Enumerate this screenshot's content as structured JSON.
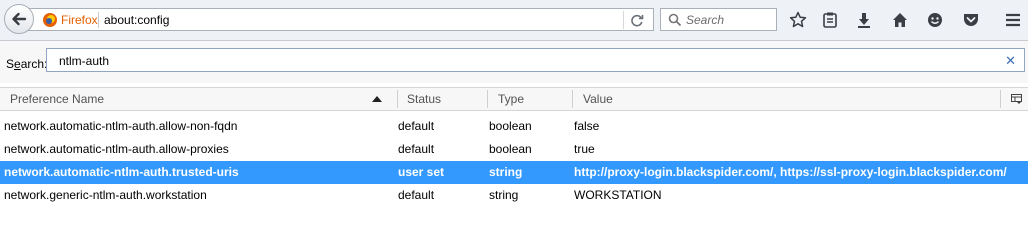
{
  "toolbar": {
    "brand_label": "Firefox",
    "url": "about:config",
    "search_placeholder": "Search"
  },
  "filter": {
    "label_prefix": "S",
    "label_underlined": "e",
    "label_suffix": "arch:",
    "value": "ntlm-auth"
  },
  "table": {
    "columns": [
      "Preference Name",
      "Status",
      "Type",
      "Value"
    ],
    "sort_column": "Preference Name",
    "sort_direction": "ascending",
    "rows": [
      {
        "name": "network.automatic-ntlm-auth.allow-non-fqdn",
        "status": "default",
        "type": "boolean",
        "value": "false",
        "selected": false
      },
      {
        "name": "network.automatic-ntlm-auth.allow-proxies",
        "status": "default",
        "type": "boolean",
        "value": "true",
        "selected": false
      },
      {
        "name": "network.automatic-ntlm-auth.trusted-uris",
        "status": "user set",
        "type": "string",
        "value": "http://proxy-login.blackspider.com/, https://ssl-proxy-login.blackspider.com/",
        "selected": true
      },
      {
        "name": "network.generic-ntlm-auth.workstation",
        "status": "default",
        "type": "string",
        "value": "WORKSTATION",
        "selected": false
      }
    ]
  },
  "colors": {
    "selection": "#3399ff",
    "brand": "#e66000",
    "clear_icon": "#3c6eb4"
  },
  "icons": [
    "back-arrow-icon",
    "firefox-logo-icon",
    "reload-icon",
    "magnifier-icon",
    "star-icon",
    "reading-list-icon",
    "download-icon",
    "home-icon",
    "hello-icon",
    "pocket-icon",
    "menu-icon",
    "clear-icon",
    "sort-ascending-icon",
    "column-picker-icon"
  ]
}
